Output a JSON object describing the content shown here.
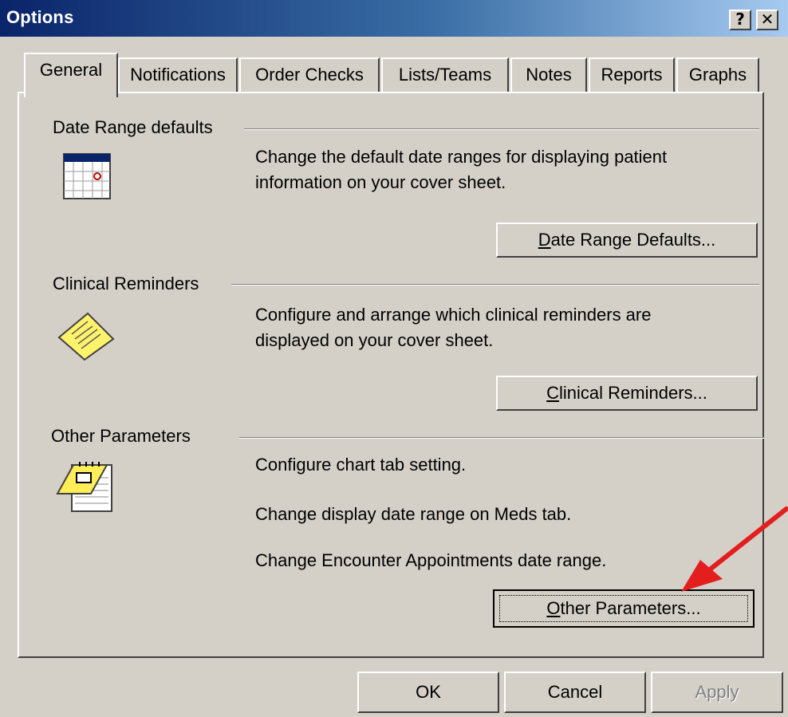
{
  "window": {
    "title": "Options",
    "help_label": "?",
    "close_label": "✕"
  },
  "tabs": [
    {
      "label": "General",
      "active": true
    },
    {
      "label": "Notifications"
    },
    {
      "label": "Order Checks"
    },
    {
      "label": "Lists/Teams"
    },
    {
      "label": "Notes"
    },
    {
      "label": "Reports"
    },
    {
      "label": "Graphs"
    }
  ],
  "sections": {
    "date_range": {
      "title": "Date Range defaults",
      "description": [
        "Change the default date ranges for displaying patient",
        "information on your cover sheet."
      ],
      "button_accel": "D",
      "button_rest": "ate Range Defaults...",
      "icon": "calendar-icon"
    },
    "clinical_reminders": {
      "title": "Clinical Reminders",
      "description": [
        "Configure and arrange which clinical reminders are",
        "displayed on your cover sheet."
      ],
      "button_accel": "C",
      "button_rest": "linical Reminders...",
      "icon": "reminder-note-icon"
    },
    "other_parameters": {
      "title": "Other Parameters",
      "description": [
        "Configure chart tab setting.",
        "Change display date range on Meds tab.",
        "Change Encounter Appointments date range."
      ],
      "button_accel": "O",
      "button_rest": "ther Parameters...",
      "icon": "notepad-icon"
    }
  },
  "footer": {
    "ok": "OK",
    "cancel": "Cancel",
    "apply": "Apply"
  },
  "colors": {
    "face": "#d4d0c8",
    "titlebar_start": "#0a246a",
    "titlebar_end": "#a6caf0",
    "annotation_arrow": "#e31e1e"
  }
}
